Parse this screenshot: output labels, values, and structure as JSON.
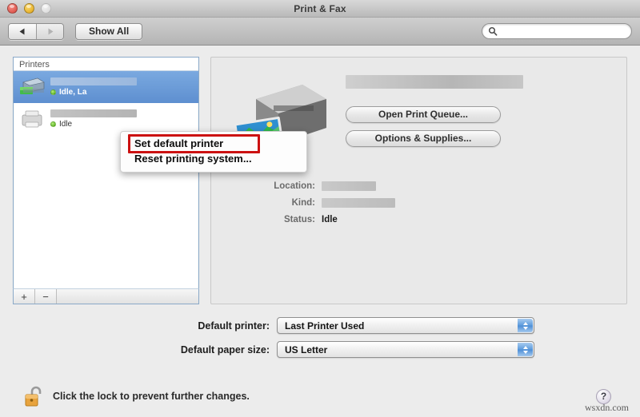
{
  "window": {
    "title": "Print & Fax",
    "controls": {
      "close": "close-button",
      "minimize": "minimize-button",
      "zoom": "zoom-button"
    }
  },
  "toolbar": {
    "back_label": "◀",
    "forward_label": "▶",
    "show_all_label": "Show All",
    "search": {
      "value": "",
      "placeholder": ""
    }
  },
  "printer_list": {
    "header": "Printers",
    "items": [
      {
        "name": "",
        "name_redacted": true,
        "status": "Idle, La",
        "selected": true,
        "icon": "printer-icon"
      },
      {
        "name": "",
        "name_redacted": true,
        "status": "Idle",
        "selected": false,
        "icon": "printer-icon"
      }
    ],
    "add_label": "+",
    "remove_label": "−"
  },
  "context_menu": {
    "items": [
      {
        "label": "Set default printer",
        "highlighted": true
      },
      {
        "label": "Reset printing system...",
        "highlighted": false
      }
    ]
  },
  "detail": {
    "printer_name": "",
    "printer_name_redacted": true,
    "open_queue_label": "Open Print Queue...",
    "options_label": "Options & Supplies...",
    "info": [
      {
        "label": "Location:",
        "value": "",
        "redacted": true
      },
      {
        "label": "Kind:",
        "value": "",
        "redacted": true
      },
      {
        "label": "Status:",
        "value": "Idle",
        "redacted": false
      }
    ]
  },
  "form": {
    "default_printer": {
      "label": "Default printer:",
      "value": "Last Printer Used"
    },
    "default_paper_size": {
      "label": "Default paper size:",
      "value": "US Letter"
    }
  },
  "footer": {
    "lock_text": "Click the lock to prevent further changes.",
    "lock_state": "unlocked",
    "help_label": "?"
  },
  "watermark": "wsxdn.com",
  "colors": {
    "selection_blue": "#5e8fd0",
    "status_green": "#4aa515",
    "highlight_red": "#cc1111",
    "lock_orange": "#e8a33d"
  }
}
